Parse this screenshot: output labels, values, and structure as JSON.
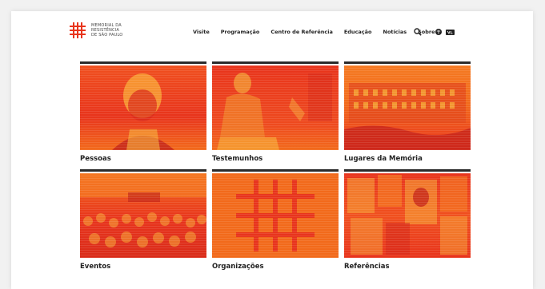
{
  "header": {
    "logo_lines": [
      "Memorial da",
      "Resistência",
      "de São Paulo"
    ],
    "nav": [
      "Visite",
      "Programação",
      "Centro de Referência",
      "Educação",
      "Notícias",
      "Sobre"
    ],
    "icons": [
      "search-icon",
      "language-icon",
      "accessibility-icon"
    ]
  },
  "tiles": [
    {
      "label": "Pessoas"
    },
    {
      "label": "Testemunhos"
    },
    {
      "label": "Lugares da Memória"
    },
    {
      "label": "Eventos"
    },
    {
      "label": "Organizações"
    },
    {
      "label": "Referências"
    }
  ],
  "colors": {
    "accent_red": "#e8341c",
    "accent_orange": "#f26a1b",
    "rule": "#2b2b2b"
  }
}
